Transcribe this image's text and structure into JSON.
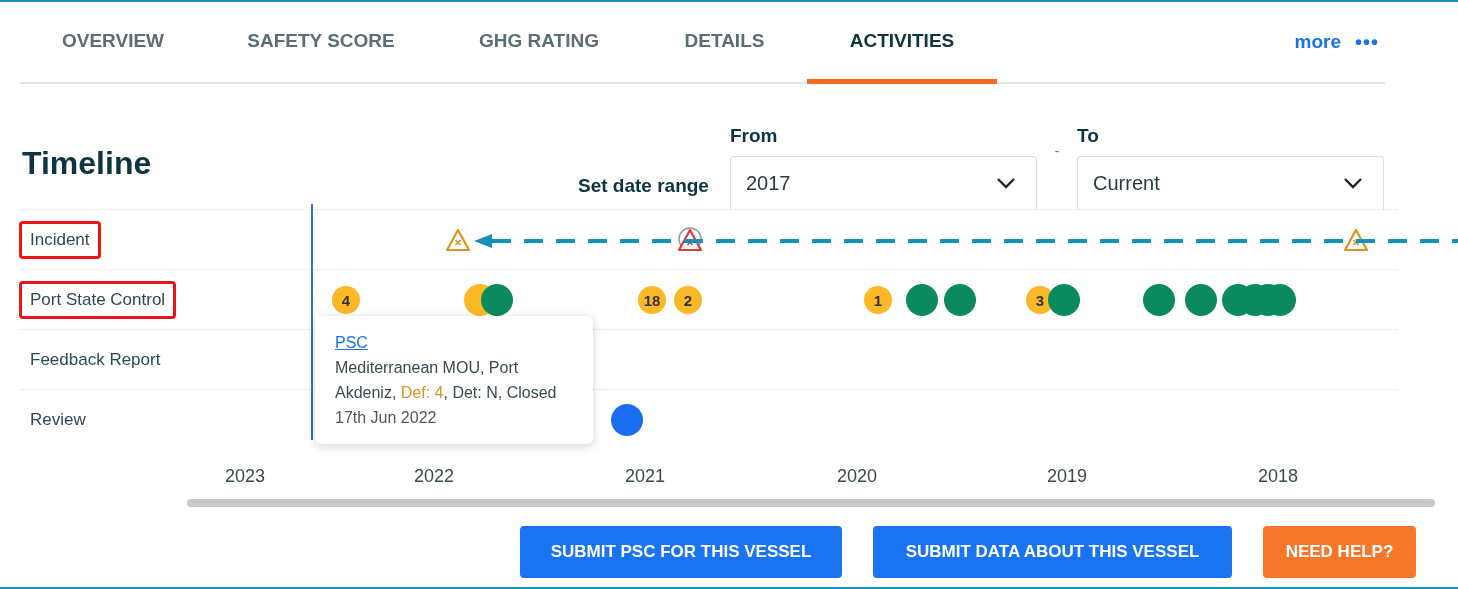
{
  "tabs": [
    {
      "label": "OVERVIEW",
      "selected": false
    },
    {
      "label": "SAFETY SCORE",
      "selected": false
    },
    {
      "label": "GHG RATING",
      "selected": false
    },
    {
      "label": "DETAILS",
      "selected": false
    },
    {
      "label": "ACTIVITIES",
      "selected": true
    }
  ],
  "more": {
    "label": "more",
    "icon": "•••"
  },
  "timeline": {
    "title": "Timeline",
    "date_range_label": "Set date range",
    "from": {
      "label": "From",
      "value": "2017"
    },
    "separator": "-",
    "to": {
      "label": "To",
      "value": "Current"
    },
    "rows": [
      {
        "label": "Incident",
        "highlighted": true,
        "markers": [
          {
            "kind": "warning",
            "color": "#d9951f"
          },
          {
            "kind": "warning-crossed",
            "color": "#e53935"
          },
          {
            "kind": "warning",
            "color": "#d9951f"
          }
        ]
      },
      {
        "label": "Port State Control",
        "highlighted": true,
        "markers": [
          {
            "kind": "count",
            "label": "4",
            "color": "#fbb928"
          },
          {
            "kind": "dot",
            "color": "#fbb928"
          },
          {
            "kind": "dot",
            "color": "#0b8a5f"
          },
          {
            "kind": "count",
            "label": "18",
            "color": "#fbb928"
          },
          {
            "kind": "count",
            "label": "2",
            "color": "#fbb928"
          },
          {
            "kind": "count",
            "label": "1",
            "color": "#fbb928"
          },
          {
            "kind": "dot",
            "color": "#0b8a5f"
          },
          {
            "kind": "dot",
            "color": "#0b8a5f"
          },
          {
            "kind": "count",
            "label": "3",
            "color": "#fbb928"
          },
          {
            "kind": "dot",
            "color": "#0b8a5f"
          },
          {
            "kind": "dot",
            "color": "#0b8a5f"
          },
          {
            "kind": "dot",
            "color": "#0b8a5f"
          },
          {
            "kind": "dot",
            "color": "#0b8a5f"
          },
          {
            "kind": "dot",
            "color": "#0b8a5f"
          },
          {
            "kind": "dot",
            "color": "#0b8a5f"
          },
          {
            "kind": "dot",
            "color": "#0b8a5f"
          }
        ]
      },
      {
        "label": "Feedback Report",
        "highlighted": false,
        "markers": []
      },
      {
        "label": "Review",
        "highlighted": false,
        "markers": [
          {
            "kind": "dot",
            "color": "#1a6cf0"
          }
        ]
      }
    ],
    "tooltip": {
      "link": "PSC",
      "details": [
        {
          "text": "Mediterranean MOU, Port Akdeniz, ",
          "highlight": false
        },
        {
          "text": "Def: 4",
          "highlight": true
        },
        {
          "text": ", Det: N, Closed",
          "highlight": false
        }
      ],
      "date": "17th Jun 2022"
    },
    "years": [
      "2023",
      "2022",
      "2021",
      "2020",
      "2019",
      "2018"
    ]
  },
  "buttons": [
    {
      "label": "SUBMIT PSC FOR THIS VESSEL",
      "kind": "primary"
    },
    {
      "label": "SUBMIT DATA ABOUT THIS VESSEL",
      "kind": "primary"
    },
    {
      "label": "NEED HELP?",
      "kind": "help"
    }
  ]
}
